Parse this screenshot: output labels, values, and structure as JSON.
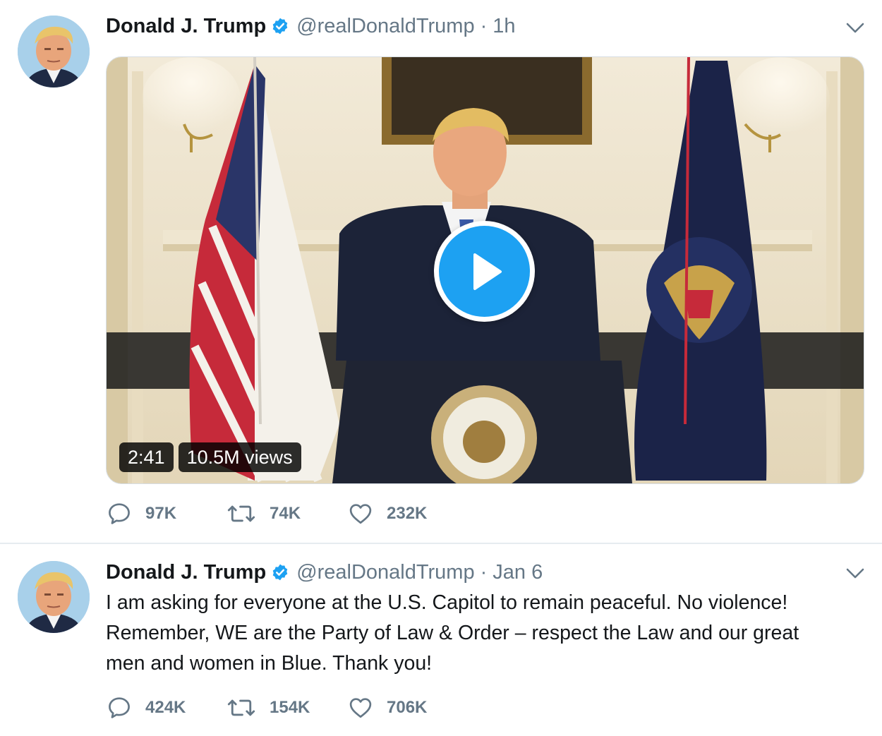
{
  "tweets": [
    {
      "author_name": "Donald J. Trump",
      "handle": "@realDonaldTrump",
      "separator": "·",
      "time": "1h",
      "media": {
        "duration": "2:41",
        "views": "10.5M views"
      },
      "stats": {
        "replies": "97K",
        "retweets": "74K",
        "likes": "232K"
      }
    },
    {
      "author_name": "Donald J. Trump",
      "handle": "@realDonaldTrump",
      "separator": "·",
      "time": "Jan 6",
      "text_lines": [
        "I am asking for everyone at the U.S. Capitol to remain peaceful. No violence!",
        "Remember, WE are the Party of Law & Order – respect the Law and our great",
        "men and women in Blue. Thank you!"
      ],
      "stats": {
        "replies": "424K",
        "retweets": "154K",
        "likes": "706K"
      }
    }
  ],
  "icons": {
    "verified": "verified-badge-icon",
    "chevron": "chevron-down-icon",
    "reply": "reply-bubble-icon",
    "retweet": "retweet-arrows-icon",
    "like": "heart-icon",
    "play": "play-icon"
  },
  "colors": {
    "accent": "#1da1f2",
    "secondary_text": "#657786",
    "primary_text": "#14171a",
    "divider": "#e6ecf0"
  }
}
